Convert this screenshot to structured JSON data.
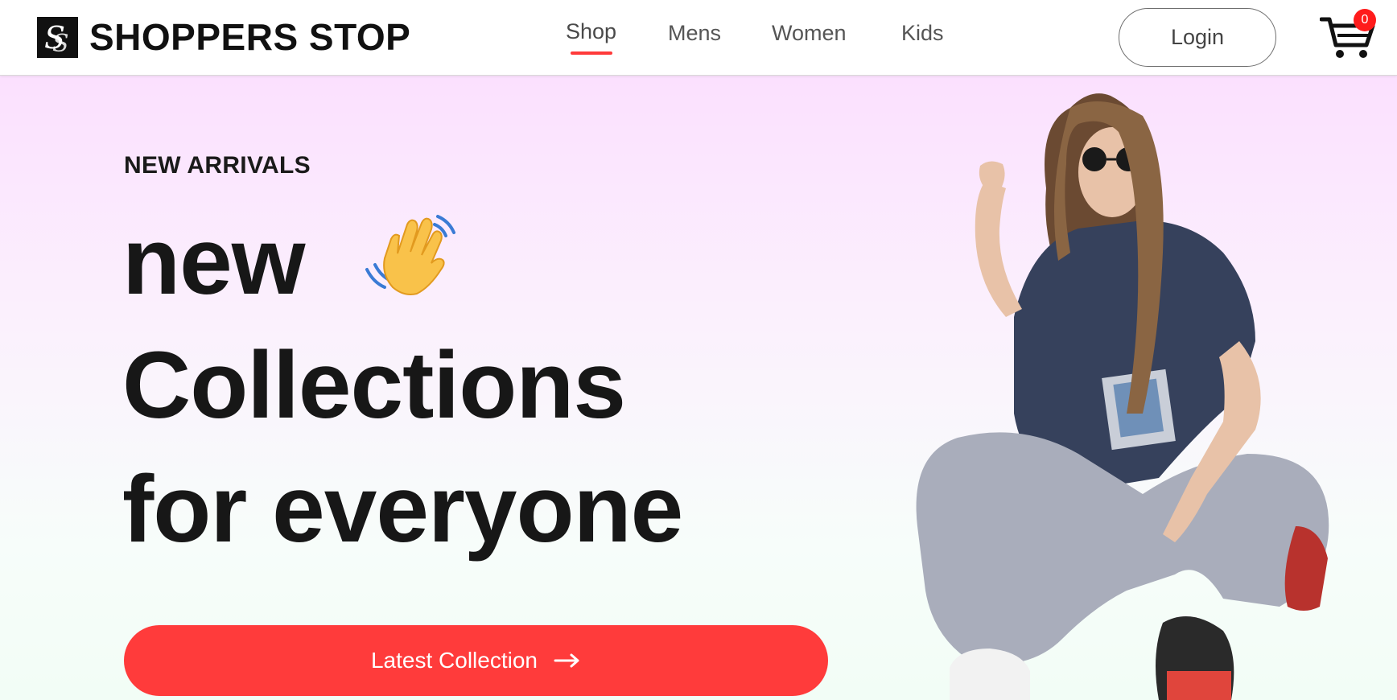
{
  "brand": {
    "name": "SHOPPERS STOP",
    "logo_icon": "ss-monogram-logo"
  },
  "nav": {
    "items": [
      {
        "label": "Shop",
        "active": true
      },
      {
        "label": "Mens",
        "active": false
      },
      {
        "label": "Women",
        "active": false
      },
      {
        "label": "Kids",
        "active": false
      }
    ],
    "login_label": "Login",
    "cart_icon": "cart-icon",
    "cart_count": "0"
  },
  "hero": {
    "eyebrow": "NEW ARRIVALS",
    "headline": [
      "new",
      "Collections",
      "for everyone"
    ],
    "emoji_icon": "waving-hand-icon",
    "cta_label": "Latest Collection",
    "cta_icon": "arrow-right-icon",
    "image": "woman-in-sunglasses-photo"
  },
  "colors": {
    "accent": "#ff3b3b",
    "badge": "#ff1b1b",
    "text_dark": "#171717",
    "hero_gradient_top": "#fbe0fe",
    "hero_gradient_bottom": "#f2fdf6"
  }
}
